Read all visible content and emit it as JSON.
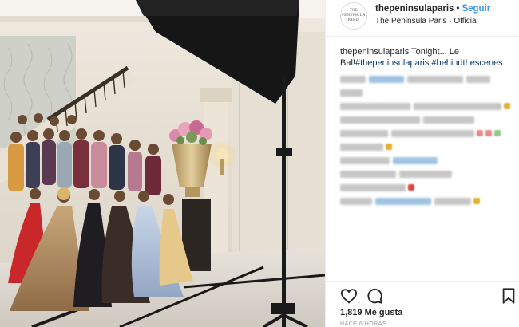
{
  "post": {
    "header": {
      "username": "thepeninsulaparis",
      "separator": "•",
      "follow_label": "Seguir",
      "location": "The Peninsula Paris · Official",
      "avatar_text_line1": "THE PENINSULA",
      "avatar_text_line2": "PARIS"
    },
    "caption": {
      "username": "thepeninsulaparis",
      "text": " Tonight... Le Bal!",
      "hashtag_1": "#thepeninsulaparis",
      "hashtag_2": " #behindthescenes"
    },
    "actions": {
      "like_icon": "heart-icon",
      "comment_icon": "comment-icon",
      "save_icon": "bookmark-icon"
    },
    "likes_text": "1,819 Me gusta",
    "timestamp_text": "HACE 6 HORAS"
  },
  "colors": {
    "link_blue": "#3897f0",
    "hashtag_blue": "#003569",
    "text": "#262626",
    "divider": "#efefef"
  }
}
